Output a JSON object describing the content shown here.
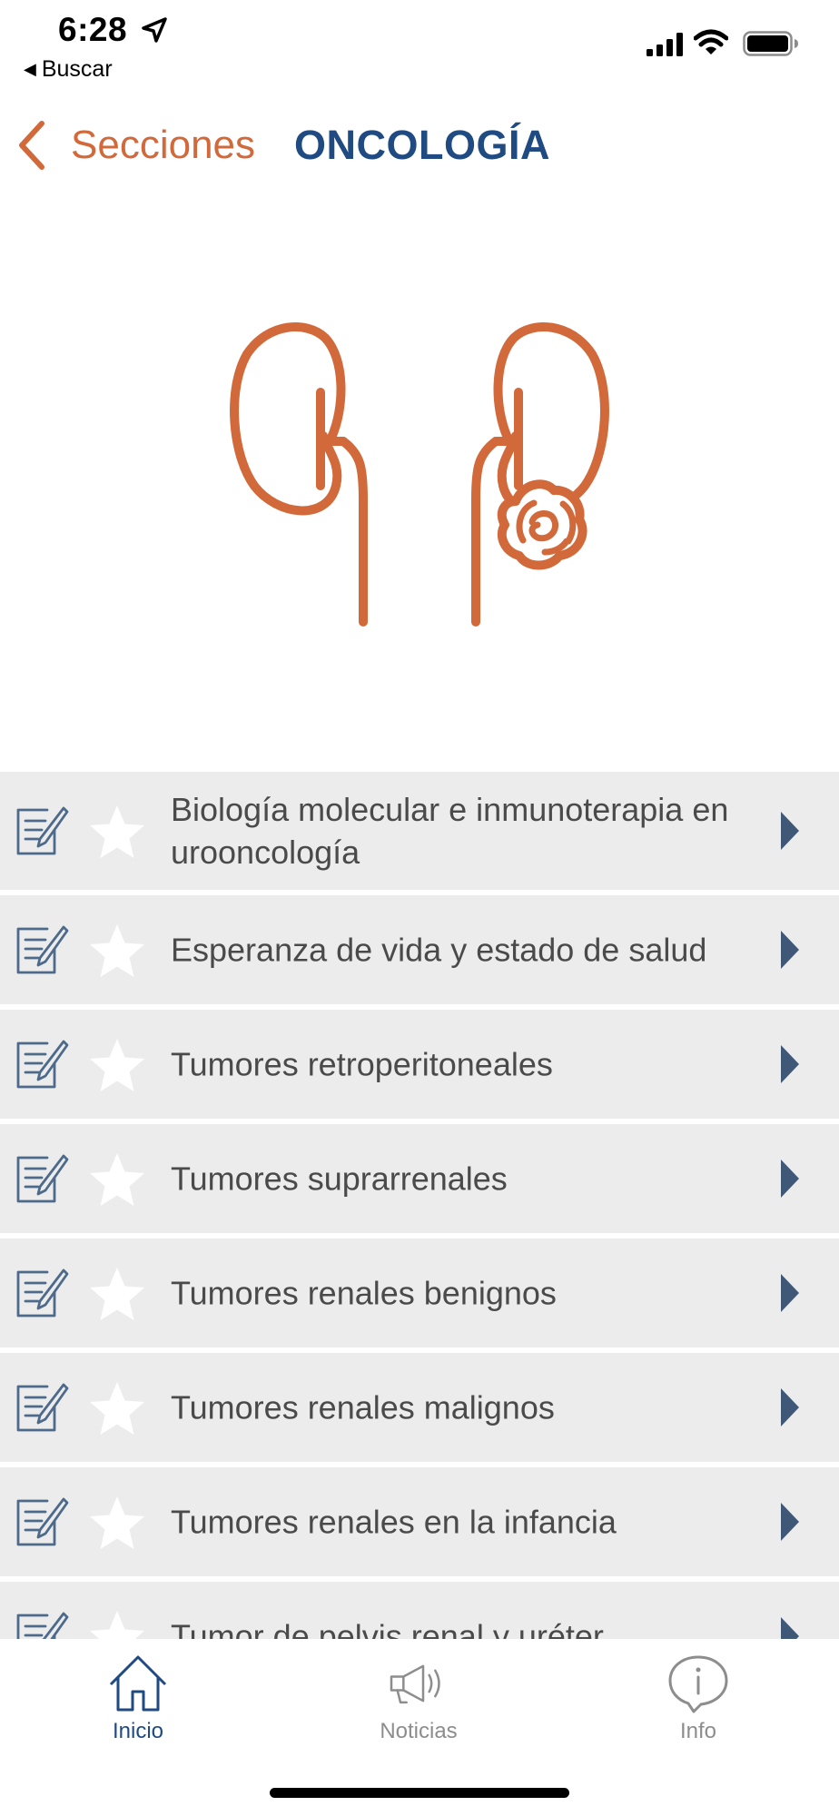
{
  "status_bar": {
    "time": "6:28",
    "back_app_label": "Buscar"
  },
  "nav": {
    "back_label": "Secciones",
    "title": "ONCOLOGÍA"
  },
  "colors": {
    "accent_orange": "#d2693a",
    "title_blue": "#1f4a82",
    "row_background": "#ececec",
    "arrow": "#3f5877"
  },
  "illustration": {
    "icon": "kidneys-with-tumor-icon"
  },
  "list": {
    "items": [
      {
        "label": "Biología molecular e inmunoterapia en urooncología"
      },
      {
        "label": "Esperanza de vida y estado de salud"
      },
      {
        "label": "Tumores retroperitoneales"
      },
      {
        "label": "Tumores suprarrenales"
      },
      {
        "label": "Tumores renales benignos"
      },
      {
        "label": "Tumores renales malignos"
      },
      {
        "label": "Tumores renales en la infancia"
      },
      {
        "label": "Tumor de pelvis renal y uréter"
      }
    ]
  },
  "tabs": [
    {
      "label": "Inicio",
      "icon": "home-icon",
      "active": true
    },
    {
      "label": "Noticias",
      "icon": "megaphone-icon",
      "active": false
    },
    {
      "label": "Info",
      "icon": "info-bubble-icon",
      "active": false
    }
  ]
}
